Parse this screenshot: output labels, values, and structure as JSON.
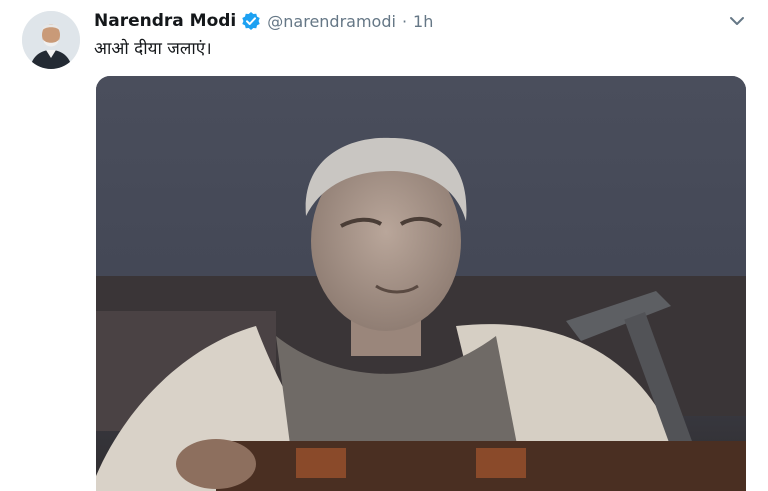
{
  "tweet": {
    "author_name": "Narendra Modi",
    "handle": "@narendramodi",
    "separator": "·",
    "time": "1h",
    "text": "आओ दीया जलाएं।"
  },
  "icons": {
    "verified": "verified-badge-icon",
    "menu": "chevron-down-icon"
  },
  "colors": {
    "verified": "#1da1f2",
    "secondary_text": "#657786",
    "primary_text": "#14171a"
  }
}
